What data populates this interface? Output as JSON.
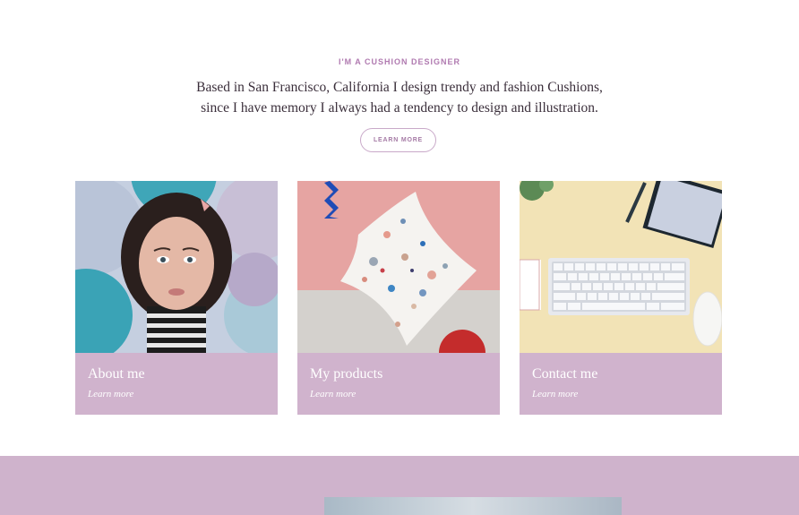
{
  "hero": {
    "eyebrow": "I'M A CUSHION DESIGNER",
    "line1": "Based in San Francisco, California I design trendy and fashion Cushions,",
    "line2": "since I have memory I always had a tendency to design and illustration.",
    "button_label": "LEARN MORE"
  },
  "cards": [
    {
      "title": "About me",
      "link": "Learn more",
      "image": "girl-with-balloons-photo"
    },
    {
      "title": "My products",
      "link": "Learn more",
      "image": "terrazzo-cushion-photo"
    },
    {
      "title": "Contact me",
      "link": "Learn more",
      "image": "desk-keyboard-photo"
    }
  ],
  "colors": {
    "accent": "#b07ab0",
    "card_bg": "#d0b3cd",
    "band_bg": "#cfb3cc"
  }
}
